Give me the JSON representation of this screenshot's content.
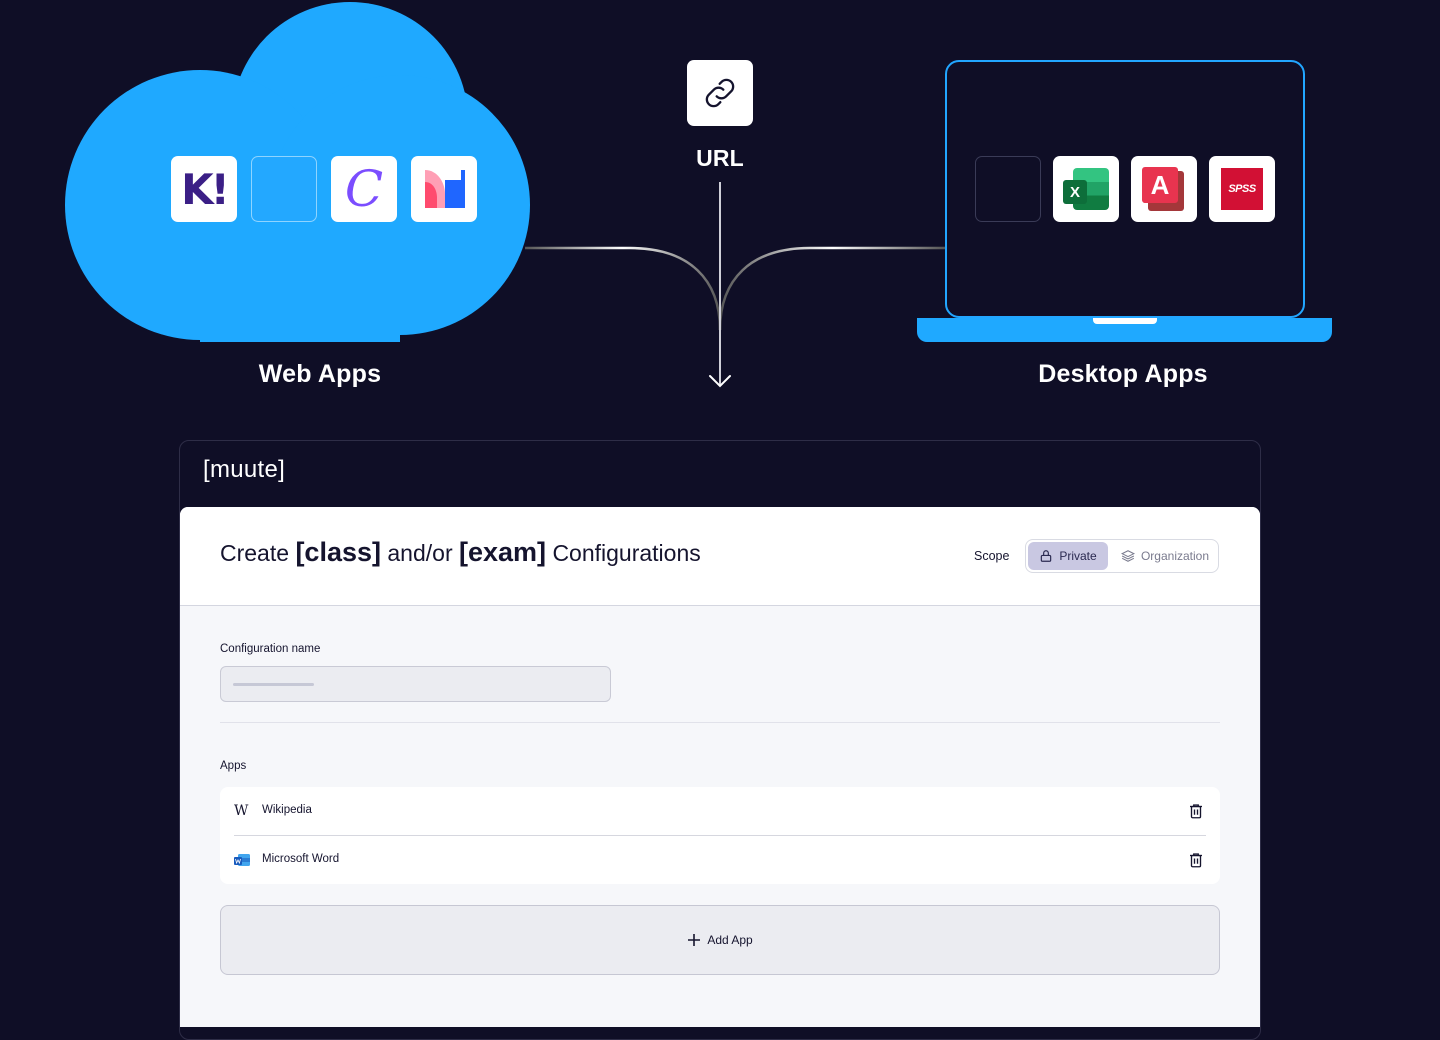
{
  "diagram": {
    "web_apps_caption": "Web Apps",
    "url_caption": "URL",
    "desktop_apps_caption": "Desktop Apps",
    "web_app_icons": [
      "khan-academy-icon",
      "empty-slot",
      "canva-icon",
      "nearpod-icon"
    ],
    "desktop_app_icons": [
      "empty-slot",
      "excel-icon",
      "access-icon",
      "spss-icon"
    ],
    "khan_letters": "K!",
    "canva_letter": "C",
    "access_letter": "A",
    "spss_label": "SPSS",
    "excel_letter": "X"
  },
  "brand": "[muute]",
  "header": {
    "title_prefix": "Create",
    "title_class": "[class]",
    "title_middle": "and/or",
    "title_exam": "[exam]",
    "title_suffix": "Configurations",
    "scope_label": "Scope",
    "scope_private": "Private",
    "scope_organization": "Organization"
  },
  "form": {
    "config_name_label": "Configuration name",
    "config_name_value": "",
    "apps_label": "Apps",
    "apps": [
      {
        "name": "Wikipedia",
        "icon": "wikipedia-icon"
      },
      {
        "name": "Microsoft Word",
        "icon": "word-icon"
      }
    ],
    "add_app_label": "Add App"
  },
  "colors": {
    "background": "#0f0e26",
    "accent_blue": "#1fa9ff",
    "private_selected": "#c9c8e2"
  }
}
